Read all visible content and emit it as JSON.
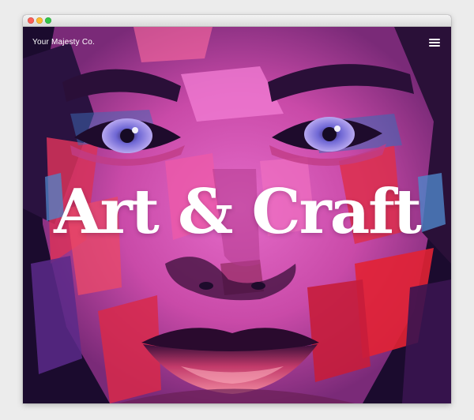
{
  "window": {
    "controls": [
      "close",
      "minimize",
      "zoom"
    ],
    "colors": {
      "close": "#fc5f57",
      "minimize": "#fdbc2e",
      "zoom": "#33c748"
    }
  },
  "header": {
    "brand": "Your Majesty Co.",
    "menu_icon": "hamburger-menu-icon"
  },
  "hero": {
    "title": "Art & Craft",
    "image": "painted-portrait-face",
    "palette": {
      "magenta": "#d24fb0",
      "pink": "#e66ac8",
      "red": "#e02a3a",
      "violet": "#8a5ad6",
      "navy": "#1b0b2e",
      "blue": "#4f86c9"
    }
  }
}
